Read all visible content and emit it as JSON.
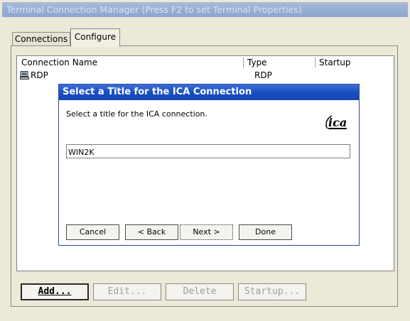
{
  "window": {
    "title": "Terminal Connection Manager (Press F2 to set Terminal Properties)"
  },
  "tabs": [
    {
      "label": "Connections",
      "selected": false
    },
    {
      "label": "Configure",
      "selected": true
    }
  ],
  "list": {
    "columns": [
      "Connection Name",
      "Type",
      "Startup"
    ],
    "rows": [
      {
        "name": "RDP",
        "type": "RDP",
        "startup": "",
        "icon": "computer-icon"
      }
    ]
  },
  "buttons": {
    "add": "Add...",
    "edit": "Edit...",
    "delete": "Delete",
    "startup": "Startup..."
  },
  "dialog": {
    "title": "Select a Title for the ICA Connection",
    "prompt": "Select a title for the ICA connection.",
    "logo": "ica",
    "input_value": "WIN2K",
    "buttons": {
      "cancel": "Cancel",
      "back": "< Back",
      "next": "Next >",
      "done": "Done"
    }
  },
  "colors": {
    "dialog_title": "#1a4fc2",
    "inactive_title": "#97aed3",
    "window_bg": "#ece9d8"
  }
}
